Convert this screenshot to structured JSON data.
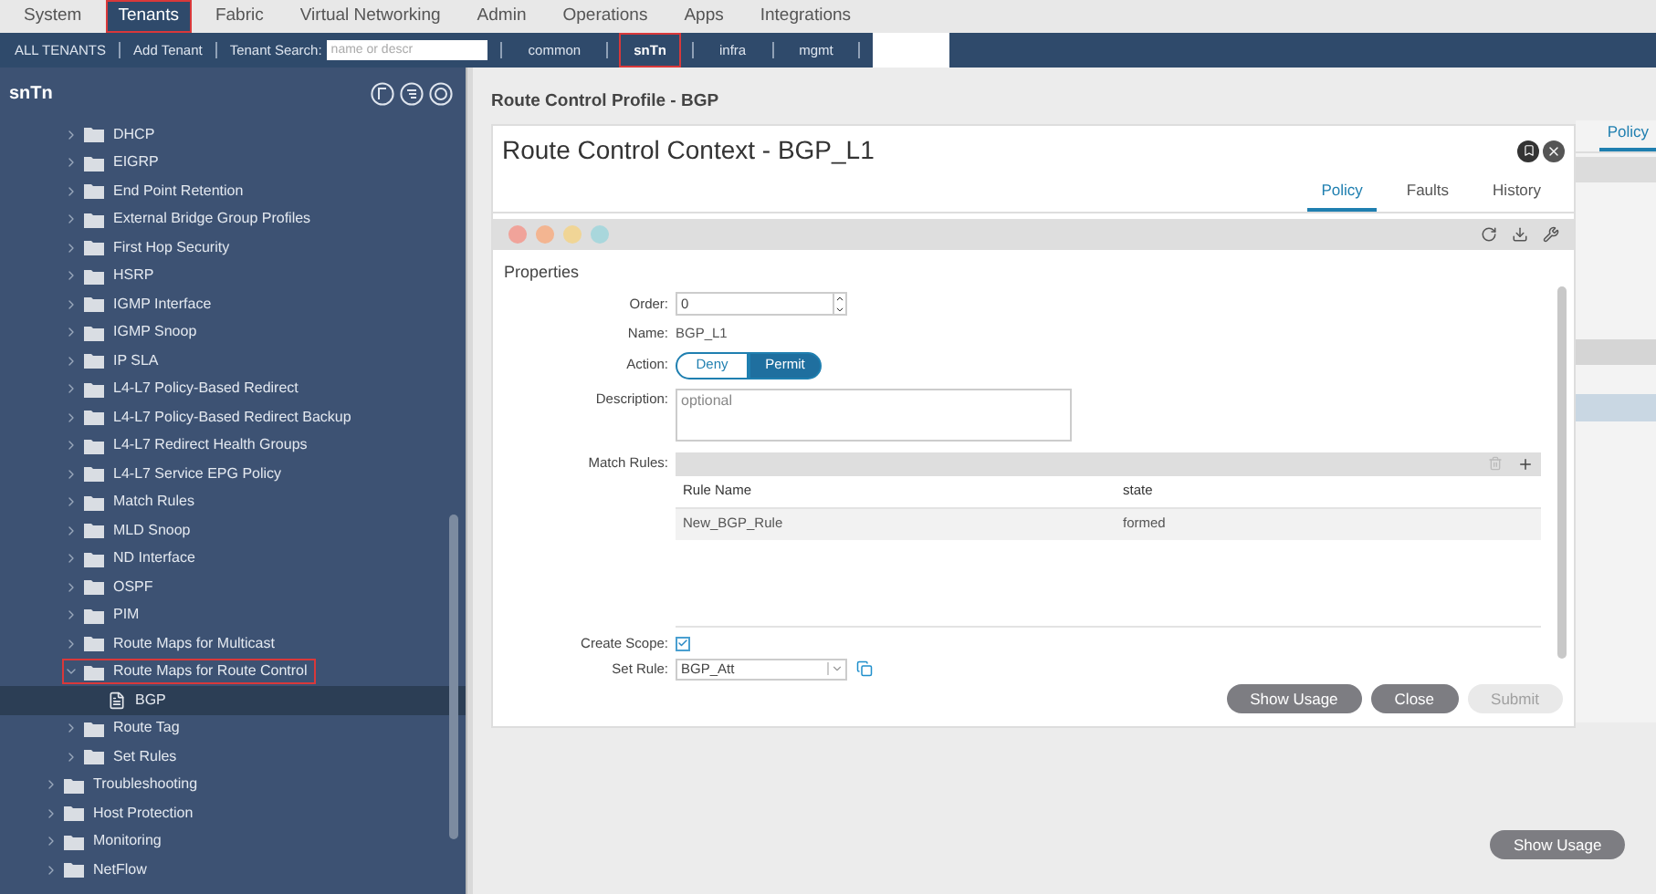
{
  "top_nav": [
    {
      "label": "System",
      "selected": false,
      "highlighted": false
    },
    {
      "label": "Tenants",
      "selected": true,
      "highlighted": true
    },
    {
      "label": "Fabric",
      "selected": false,
      "highlighted": false
    },
    {
      "label": "Virtual Networking",
      "selected": false,
      "highlighted": false
    },
    {
      "label": "Admin",
      "selected": false,
      "highlighted": false
    },
    {
      "label": "Operations",
      "selected": false,
      "highlighted": false
    },
    {
      "label": "Apps",
      "selected": false,
      "highlighted": false
    },
    {
      "label": "Integrations",
      "selected": false,
      "highlighted": false
    }
  ],
  "sub_nav": {
    "links": [
      "ALL TENANTS",
      "Add Tenant"
    ],
    "search_label": "Tenant Search:",
    "search_placeholder": "name or descr",
    "tenants": [
      {
        "label": "common",
        "selected": false,
        "highlighted": false
      },
      {
        "label": "snTn",
        "selected": true,
        "highlighted": true
      },
      {
        "label": "infra",
        "selected": false,
        "highlighted": false
      },
      {
        "label": "mgmt",
        "selected": false,
        "highlighted": false
      }
    ]
  },
  "sidebar": {
    "title": "snTn",
    "tree": [
      {
        "children": [
          {
            "label": "DHCP",
            "kind": "folder",
            "expanded": false,
            "selected": false,
            "highlighted": false
          },
          {
            "label": "EIGRP",
            "kind": "folder",
            "expanded": false,
            "selected": false,
            "highlighted": false
          },
          {
            "label": "End Point Retention",
            "kind": "folder",
            "expanded": false,
            "selected": false,
            "highlighted": false
          },
          {
            "label": "External Bridge Group Profiles",
            "kind": "folder",
            "expanded": false,
            "selected": false,
            "highlighted": false
          },
          {
            "label": "First Hop Security",
            "kind": "folder",
            "expanded": false,
            "selected": false,
            "highlighted": false
          },
          {
            "label": "HSRP",
            "kind": "folder",
            "expanded": false,
            "selected": false,
            "highlighted": false
          },
          {
            "label": "IGMP Interface",
            "kind": "folder",
            "expanded": false,
            "selected": false,
            "highlighted": false
          },
          {
            "label": "IGMP Snoop",
            "kind": "folder",
            "expanded": false,
            "selected": false,
            "highlighted": false
          },
          {
            "label": "IP SLA",
            "kind": "folder",
            "expanded": false,
            "selected": false,
            "highlighted": false
          },
          {
            "label": "L4-L7 Policy-Based Redirect",
            "kind": "folder",
            "expanded": false,
            "selected": false,
            "highlighted": false
          },
          {
            "label": "L4-L7 Policy-Based Redirect Backup",
            "kind": "folder",
            "expanded": false,
            "selected": false,
            "highlighted": false
          },
          {
            "label": "L4-L7 Redirect Health Groups",
            "kind": "folder",
            "expanded": false,
            "selected": false,
            "highlighted": false
          },
          {
            "label": "L4-L7 Service EPG Policy",
            "kind": "folder",
            "expanded": false,
            "selected": false,
            "highlighted": false
          },
          {
            "label": "Match Rules",
            "kind": "folder",
            "expanded": false,
            "selected": false,
            "highlighted": false
          },
          {
            "label": "MLD Snoop",
            "kind": "folder",
            "expanded": false,
            "selected": false,
            "highlighted": false
          },
          {
            "label": "ND Interface",
            "kind": "folder",
            "expanded": false,
            "selected": false,
            "highlighted": false
          },
          {
            "label": "OSPF",
            "kind": "folder",
            "expanded": false,
            "selected": false,
            "highlighted": false
          },
          {
            "label": "PIM",
            "kind": "folder",
            "expanded": false,
            "selected": false,
            "highlighted": false
          },
          {
            "label": "Route Maps for Multicast",
            "kind": "folder",
            "expanded": false,
            "selected": false,
            "highlighted": false
          },
          {
            "label": "Route Maps for Route Control",
            "kind": "folder",
            "expanded": true,
            "selected": false,
            "highlighted": true,
            "children": [
              {
                "label": "BGP",
                "kind": "file",
                "selected": true,
                "highlighted": false
              }
            ]
          },
          {
            "label": "Route Tag",
            "kind": "folder",
            "expanded": false,
            "selected": false,
            "highlighted": false
          },
          {
            "label": "Set Rules",
            "kind": "folder",
            "expanded": false,
            "selected": false,
            "highlighted": false
          }
        ]
      },
      {
        "label": "Troubleshooting",
        "kind": "folder",
        "expanded": false,
        "selected": false,
        "highlighted": false
      },
      {
        "label": "Host Protection",
        "kind": "folder",
        "expanded": false,
        "selected": false,
        "highlighted": false
      },
      {
        "label": "Monitoring",
        "kind": "folder",
        "expanded": false,
        "selected": false,
        "highlighted": false
      },
      {
        "label": "NetFlow",
        "kind": "folder",
        "expanded": false,
        "selected": false,
        "highlighted": false
      }
    ]
  },
  "main": {
    "breadcrumb": "Route Control Profile - BGP",
    "dialog": {
      "title": "Route Control Context - BGP_L1",
      "tabs": [
        {
          "label": "Policy",
          "selected": true
        },
        {
          "label": "Faults",
          "selected": false
        },
        {
          "label": "History",
          "selected": false
        }
      ],
      "section": "Properties",
      "order": {
        "label": "Order:",
        "value": "0"
      },
      "name": {
        "label": "Name:",
        "value": "BGP_L1"
      },
      "action": {
        "label": "Action:",
        "options": [
          {
            "label": "Deny",
            "selected": false
          },
          {
            "label": "Permit",
            "selected": true
          }
        ]
      },
      "description": {
        "label": "Description:",
        "placeholder": "optional"
      },
      "match_rules": {
        "label": "Match Rules:",
        "columns": [
          "Rule Name",
          "state"
        ],
        "rows": [
          [
            "New_BGP_Rule",
            "formed"
          ]
        ]
      },
      "create_scope": {
        "label": "Create Scope:",
        "checked": true
      },
      "set_rule": {
        "label": "Set Rule:",
        "value": "BGP_Att"
      },
      "buttons": [
        {
          "label": "Show Usage",
          "disabled": false
        },
        {
          "label": "Close",
          "disabled": false
        },
        {
          "label": "Submit",
          "disabled": true
        }
      ]
    },
    "background_panel": {
      "tab": {
        "label": "Policy",
        "selected": true
      },
      "button": "Show Usage"
    }
  }
}
